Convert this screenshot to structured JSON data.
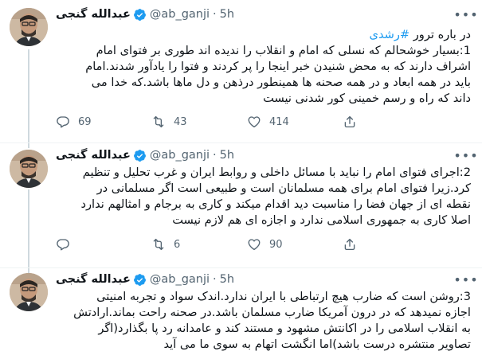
{
  "tweets": [
    {
      "author_name": "عبدالله گنجی",
      "handle": "@ab_ganji",
      "dot": "·",
      "time": "5h",
      "intro": "در باره ترور ",
      "hashtag": "#رشدی",
      "lines": [
        "1:بسیار خوشحالم که نسلی که امام و انقلاب را ندیده اند طوری بر فتوای امام",
        "اشراف دارند که به محض شنیدن خبر اینجا را پر کردند و فتوا را یادآور شدند.امام",
        "باید در همه ابعاد و در همه صحنه ها همینطور درذهن و دل ماها باشد.که خدا می",
        "داند که راه و رسم خمینی کور شدنی نیست"
      ],
      "replies": "69",
      "retweets": "43",
      "likes": "414"
    },
    {
      "author_name": "عبدالله گنجی",
      "handle": "@ab_ganji",
      "dot": "·",
      "time": "5h",
      "lines": [
        "2:اجرای فتوای امام را نباید با مسائل داخلی و روابط ایران و غرب تحلیل و تنظیم",
        "کرد.زیرا فتوای امام برای همه مسلمانان است و طبیعی است اگر مسلمانی در",
        "نقطه ای از جهان فضا را مناسبت دید اقدام میکند و کاری به برجام و امثالهم ندارد",
        "اصلا کاری به جمهوری اسلامی ندارد و اجازه ای هم لازم نیست"
      ],
      "replies": "",
      "retweets": "6",
      "likes": "90"
    },
    {
      "author_name": "عبدالله گنجی",
      "handle": "@ab_ganji",
      "dot": "·",
      "time": "5h",
      "lines": [
        "3:روشن است که ضارب هیچ ارتباطی با ایران ندارد.اندک سواد  و تجربه امنیتی",
        "اجازه نمیدهد که در درون آمریکا ضارب مسلمان باشد.در صحنه راحت بماند.ارادتش",
        "به انقلاب اسلامی را در اکانتش مشهود و مستند کند و عامدانه رد پا بگذارد(اگر",
        "تصاویر منتشره درست باشد)اما انگشت اتهام به سوی ما می آید"
      ]
    }
  ],
  "icons": {
    "more": "more-icon",
    "verified": "verified-icon",
    "reply": "reply-icon",
    "retweet": "retweet-icon",
    "like": "like-icon",
    "share": "share-icon"
  },
  "colors": {
    "accent": "#1d9bf0",
    "secondary_text": "#536471",
    "divider": "#eff3f4"
  }
}
